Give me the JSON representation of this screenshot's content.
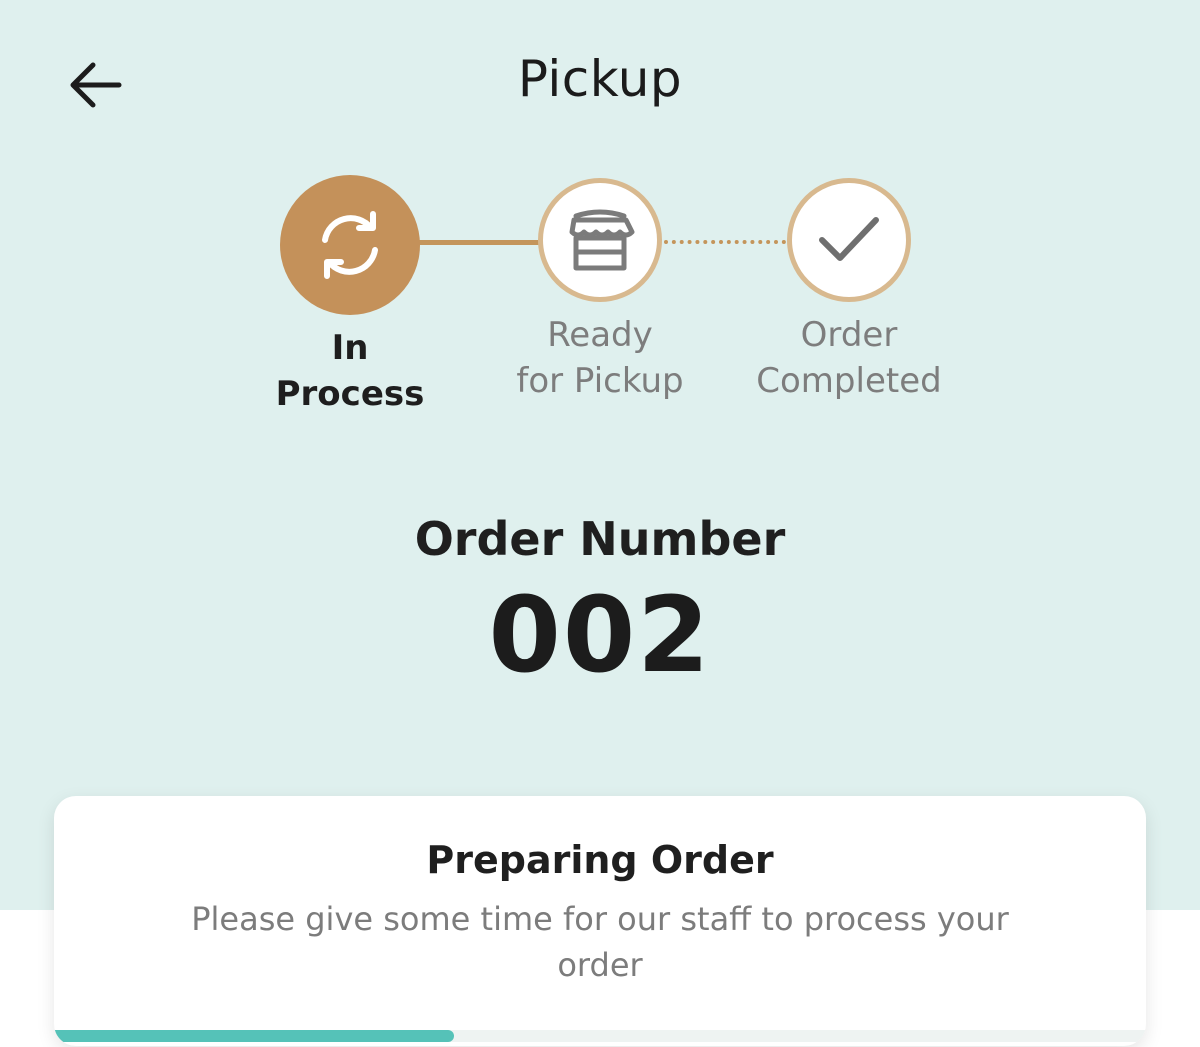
{
  "header": {
    "title": "Pickup",
    "back_icon": "arrow-left-icon"
  },
  "steps": [
    {
      "label_line1": "In",
      "label_line2": "Process",
      "icon": "refresh-icon",
      "state": "active"
    },
    {
      "label_line1": "Ready",
      "label_line2": "for Pickup",
      "icon": "store-icon",
      "state": "pending"
    },
    {
      "label_line1": "Order",
      "label_line2": "Completed",
      "icon": "check-icon",
      "state": "pending"
    }
  ],
  "order": {
    "label": "Order Number",
    "number": "002"
  },
  "status_card": {
    "title": "Preparing Order",
    "description": "Please give some time for our staff to process your order",
    "progress_fraction": 0.366
  },
  "colors": {
    "background": "#dff0ee",
    "accent": "#c4915a",
    "progress": "#55c2b8"
  }
}
